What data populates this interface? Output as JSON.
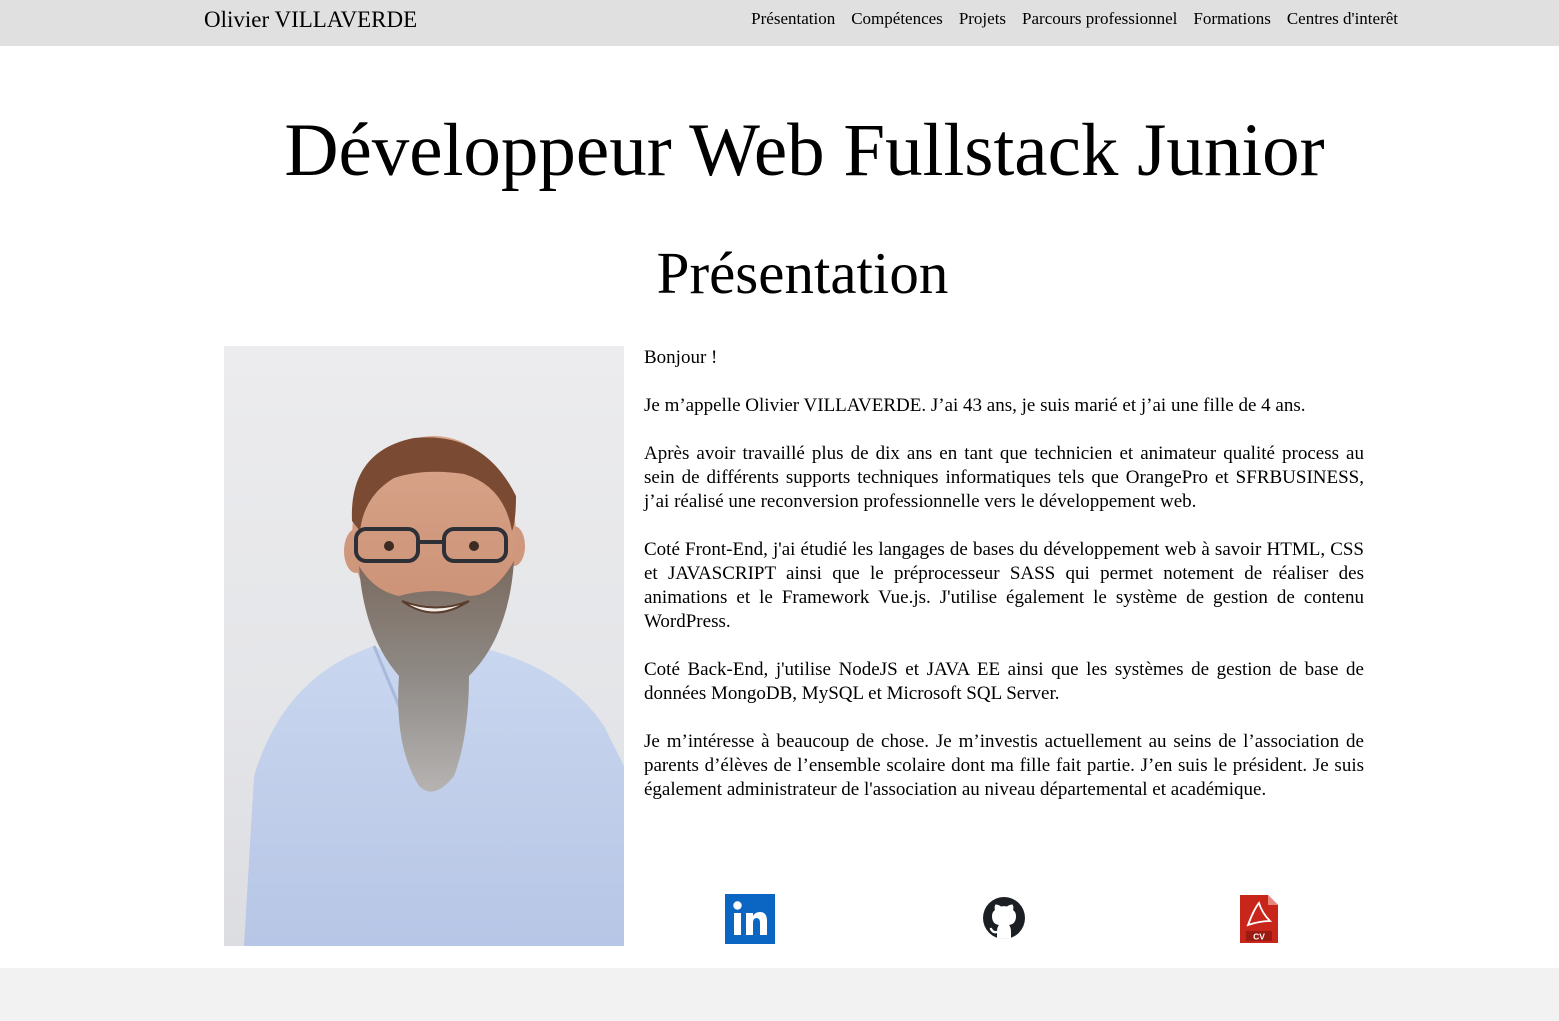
{
  "navbar": {
    "brand": "Olivier VILLAVERDE",
    "links": [
      "Présentation",
      "Compétences",
      "Projets",
      "Parcours professionnel",
      "Formations",
      "Centres d'interêt"
    ]
  },
  "main": {
    "headline": "Développeur Web Fullstack Junior",
    "section_title": "Présentation",
    "paragraphs": [
      "Bonjour !",
      "Je m’appelle Olivier VILLAVERDE. J’ai 43 ans, je suis marié et j’ai une fille de 4 ans.",
      "Après avoir travaillé plus de dix ans en tant que technicien et animateur qualité process au sein de différents supports techniques informatiques tels que OrangePro et SFRBUSINESS, j’ai réalisé une reconversion professionnelle vers le développement web.",
      "Coté Front-End, j'ai étudié les langages de bases du développement web à savoir HTML, CSS et JAVASCRIPT ainsi que le préprocesseur SASS qui permet notement de réaliser des animations et le Framework Vue.js. J'utilise également le système de gestion de contenu WordPress.",
      "Coté Back-End, j'utilise NodeJS et JAVA EE ainsi que les systèmes de gestion de base de données MongoDB, MySQL et Microsoft SQL Server.",
      "Je m’intéresse à beaucoup de chose. Je m’investis actuellement au seins de l’association de parents d’élèves de l’ensemble scolaire dont ma fille fait partie. J’en suis le président. Je suis également administrateur de l'association au niveau départemental et académique."
    ],
    "photo": {
      "icon": "profile-photo"
    },
    "socials": {
      "linkedin_icon": "linkedin-icon",
      "github_icon": "github-icon",
      "cv_icon": "pdf-cv-icon",
      "cv_label": "CV"
    }
  },
  "colors": {
    "navbar_bg": "#e0e0e0",
    "page_bg": "#ffffff",
    "footer_bg": "#f2f2f2",
    "linkedin": "#0a66c2",
    "pdf_red": "#c8261b"
  }
}
